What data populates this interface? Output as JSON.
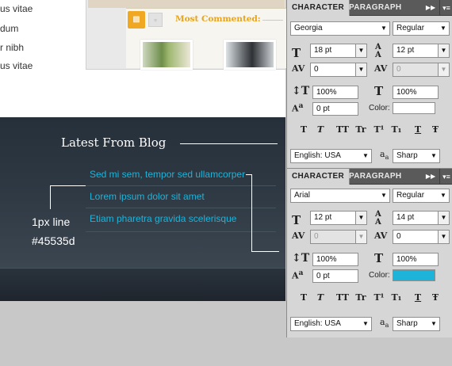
{
  "canvas": {
    "link_items": [
      "us vitae",
      "dum",
      "r nibh",
      "us vitae"
    ],
    "widget": {
      "title": "Most Commented:",
      "orange_tab_icon": "speech-bubble-icon",
      "gray_tab_icon": "square-icon"
    },
    "blog": {
      "heading": "Latest From Blog",
      "links": [
        "Sed mi sem, tempor sed ullamcorper",
        "Lorem ipsum dolor sit amet",
        "Etiam pharetra gravida scelerisque"
      ],
      "link_color": "#1eb3d8",
      "separator_color": "#45535d"
    },
    "annotation": {
      "line1": "1px line",
      "line2": "#45535d"
    }
  },
  "panel_top": {
    "tab_active": "CHARACTER",
    "tab_inactive": "PARAGRAPH",
    "font_family": "Georgia",
    "font_style": "Regular",
    "font_size": "18 pt",
    "leading": "12 pt",
    "kerning": "0",
    "tracking": "0",
    "vertical_scale": "100%",
    "horizontal_scale": "100%",
    "baseline_shift": "0 pt",
    "color_label": "Color:",
    "color_value": "#ffffff",
    "language": "English: USA",
    "antialias_icon_text": "a",
    "antialias_icon_text_small": "a",
    "antialias": "Sharp"
  },
  "panel_bottom": {
    "tab_active": "CHARACTER",
    "tab_inactive": "PARAGRAPH",
    "font_family": "Arial",
    "font_style": "Regular",
    "font_size": "12 pt",
    "leading": "14 pt",
    "kerning": "0",
    "tracking": "0",
    "vertical_scale": "100%",
    "horizontal_scale": "100%",
    "baseline_shift": "0 pt",
    "color_label": "Color:",
    "color_value": "#1eb3d8",
    "language": "English: USA",
    "antialias_icon_text": "a",
    "antialias_icon_text_small": "a",
    "antialias": "Sharp"
  },
  "format_buttons": [
    "T",
    "T",
    "TT",
    "Tr",
    "T¹",
    "T₁",
    "T",
    "Ŧ"
  ]
}
